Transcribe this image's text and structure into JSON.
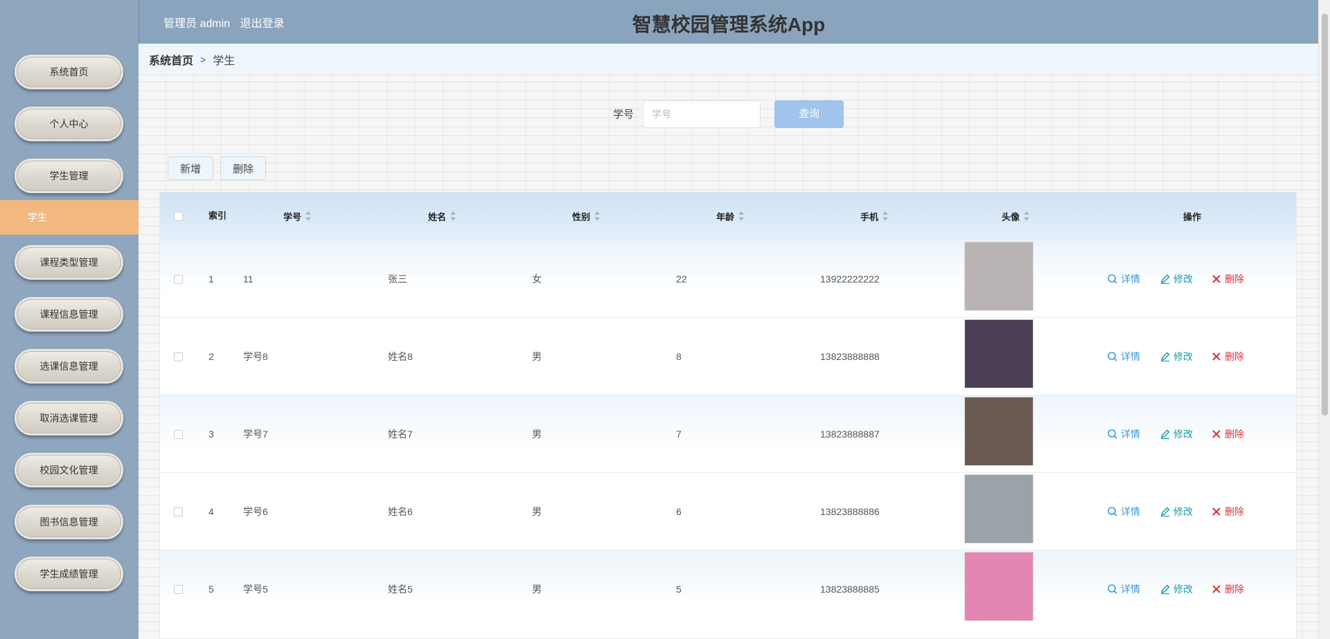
{
  "header": {
    "user_label": "管理员 admin",
    "logout_label": "退出登录",
    "app_title": "智慧校园管理系统App"
  },
  "breadcrumb": {
    "home": "系统首页",
    "separator": ">",
    "current": "学生"
  },
  "sidebar": {
    "items": [
      {
        "label": "系统首页"
      },
      {
        "label": "个人中心"
      },
      {
        "label": "学生管理"
      },
      {
        "label": "学生",
        "active": true
      },
      {
        "label": "课程类型管理"
      },
      {
        "label": "课程信息管理"
      },
      {
        "label": "选课信息管理"
      },
      {
        "label": "取消选课管理"
      },
      {
        "label": "校园文化管理"
      },
      {
        "label": "图书信息管理"
      },
      {
        "label": "学生成绩管理"
      }
    ]
  },
  "search": {
    "label": "学号",
    "placeholder": "学号",
    "value": "",
    "button": "查询"
  },
  "actions": {
    "add": "新增",
    "delete": "删除"
  },
  "table": {
    "columns": {
      "index": "索引",
      "student_id": "学号",
      "name": "姓名",
      "gender": "性别",
      "age": "年龄",
      "phone": "手机",
      "avatar": "头像",
      "ops": "操作"
    },
    "rows": [
      {
        "index": "1",
        "student_id": "11",
        "name": "张三",
        "gender": "女",
        "age": "22",
        "phone": "13922222222",
        "avatar_color": "#b9b4b3"
      },
      {
        "index": "2",
        "student_id": "学号8",
        "name": "姓名8",
        "gender": "男",
        "age": "8",
        "phone": "13823888888",
        "avatar_color": "#4a3f55"
      },
      {
        "index": "3",
        "student_id": "学号7",
        "name": "姓名7",
        "gender": "男",
        "age": "7",
        "phone": "13823888887",
        "avatar_color": "#6b5a52"
      },
      {
        "index": "4",
        "student_id": "学号6",
        "name": "姓名6",
        "gender": "男",
        "age": "6",
        "phone": "13823888886",
        "avatar_color": "#9aa3a8"
      },
      {
        "index": "5",
        "student_id": "学号5",
        "name": "姓名5",
        "gender": "男",
        "age": "5",
        "phone": "13823888885",
        "avatar_color": "#e386b4"
      }
    ],
    "row_actions": {
      "detail": "详情",
      "edit": "修改",
      "delete": "删除"
    }
  },
  "colors": {
    "sidebar_bg": "#8fa6bf",
    "header_bg": "#8aa4be",
    "active_item": "#f2b880",
    "search_button": "#a0c4ec",
    "detail_link": "#3a9bd9",
    "edit_link": "#1f9aa6",
    "delete_link": "#d9363e"
  }
}
